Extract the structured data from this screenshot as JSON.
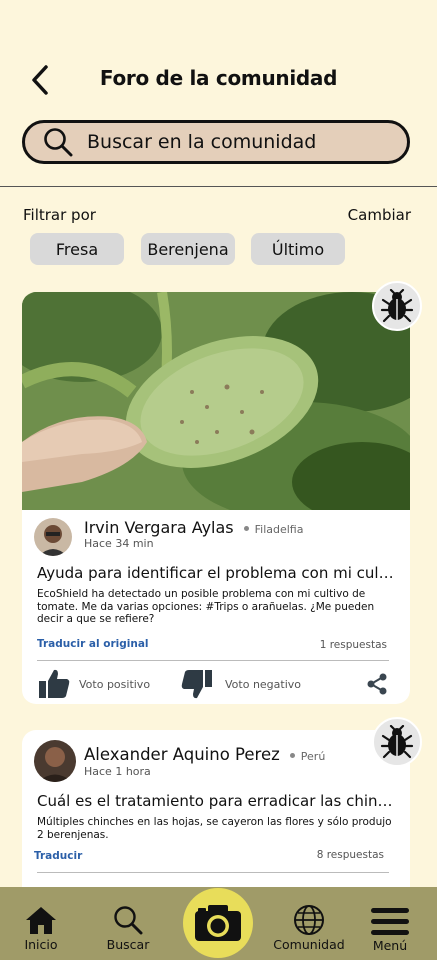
{
  "header": {
    "title": "Foro de la comunidad"
  },
  "search": {
    "placeholder": "Buscar en la comunidad"
  },
  "filters": {
    "label": "Filtrar por",
    "change": "Cambiar",
    "chips": [
      "Fresa",
      "Berenjena",
      "Último"
    ]
  },
  "posts": [
    {
      "user": "Irvin Vergara Aylas",
      "location": "Filadelfia",
      "time": "Hace 34 min",
      "title": "Ayuda para identificar el problema con mi cultivo de tomate",
      "body": "EcoShield ha detectado un posible problema con mi cultivo de tomate. Me da varias opciones: #Trips o arañuelas. ¿Me pueden decir a que se refiere?",
      "translate": "Traducir al original",
      "replies": "1 respuestas",
      "upvote": "Voto positivo",
      "downvote": "Voto negativo"
    },
    {
      "user": "Alexander Aquino Perez",
      "location": "Perú",
      "time": "Hace 1 hora",
      "title": "Cuál es el tratamiento para erradicar las chinches del cultivo",
      "body": "Múltiples chinches en las hojas, se cayeron las flores y sólo produjo 2 berenjenas.",
      "translate": "Traducir",
      "replies": "8 respuestas"
    }
  ],
  "nav": {
    "home": "Inicio",
    "search": "Buscar",
    "community": "Comunidad",
    "menu": "Menú"
  }
}
